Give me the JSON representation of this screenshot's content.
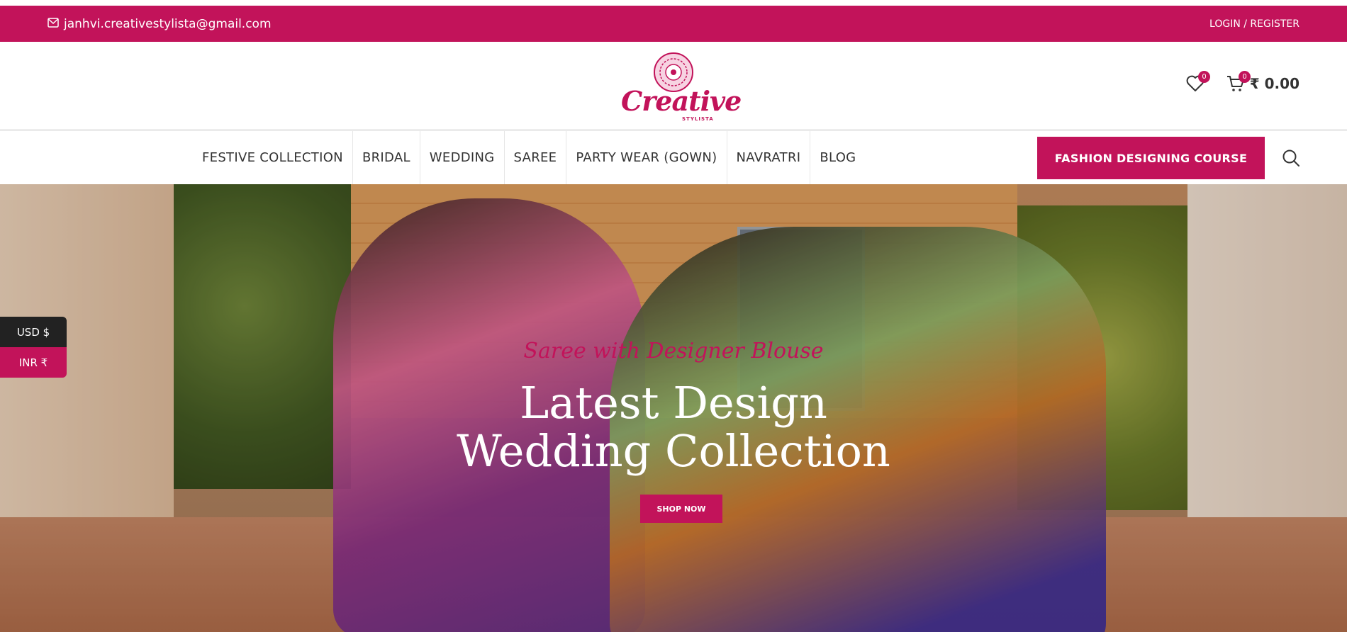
{
  "topbar": {
    "email": "janhvi.creativestylista@gmail.com",
    "login": "LOGIN / REGISTER"
  },
  "brand": {
    "name": "Creative",
    "sub": "STYLISTA"
  },
  "header": {
    "wishlist_count": "0",
    "cart_count": "0",
    "cart_total": "₹ 0.00"
  },
  "nav": {
    "items": [
      {
        "label": "FESTIVE COLLECTION"
      },
      {
        "label": "BRIDAL"
      },
      {
        "label": "WEDDING"
      },
      {
        "label": "SAREE"
      },
      {
        "label": "PARTY WEAR (GOWN)"
      },
      {
        "label": "NAVRATRI"
      },
      {
        "label": "BLOG"
      }
    ],
    "cta": "FASHION DESIGNING COURSE"
  },
  "hero": {
    "tagline": "Saree with Designer Blouse",
    "headline_1": "Latest Design",
    "headline_2": "Wedding Collection",
    "button": "SHOP NOW"
  },
  "currency": {
    "usd": "USD $",
    "inr": "INR ₹"
  },
  "colors": {
    "brand": "#c2135a",
    "dark": "#222222"
  },
  "icons": [
    "mail-icon",
    "heart-icon",
    "cart-icon",
    "search-icon"
  ]
}
